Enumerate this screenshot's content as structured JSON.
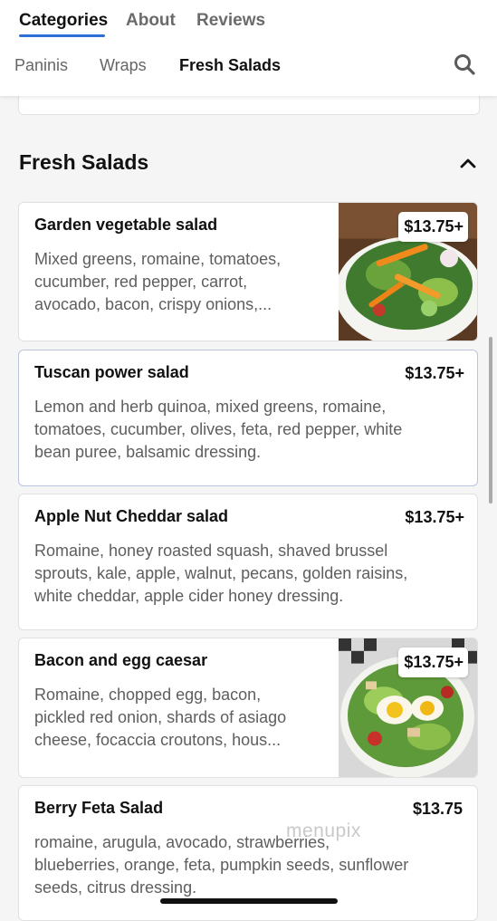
{
  "top_tabs": [
    {
      "label": "Categories",
      "active": true
    },
    {
      "label": "About",
      "active": false
    },
    {
      "label": "Reviews",
      "active": false
    }
  ],
  "sub_tabs": [
    {
      "label": "Paninis",
      "active": false
    },
    {
      "label": "Wraps",
      "active": false
    },
    {
      "label": "Fresh Salads",
      "active": true
    }
  ],
  "icons": {
    "search": "search-icon",
    "collapse": "chevron-up-icon"
  },
  "section": {
    "title": "Fresh Salads"
  },
  "items": [
    {
      "name": "Garden vegetable salad",
      "desc_lines": [
        "Mixed greens, romaine, tomatoes,",
        "cucumber, red pepper, carrot,",
        "avocado, bacon, crispy onions,..."
      ],
      "price": "$13.75+",
      "has_image": true
    },
    {
      "name": "Tuscan power salad",
      "desc_lines": [
        "Lemon and herb quinoa, mixed greens, romaine,",
        "tomatoes, cucumber, olives, feta, red pepper, white",
        "bean puree, balsamic dressing."
      ],
      "price": "$13.75+",
      "has_image": false
    },
    {
      "name": "Apple Nut Cheddar salad",
      "desc_lines": [
        "Romaine, honey roasted squash, shaved brussel",
        "sprouts, kale, apple, walnut, pecans, golden raisins,",
        "white cheddar, apple cider honey dressing."
      ],
      "price": "$13.75+",
      "has_image": false
    },
    {
      "name": "Bacon and egg caesar",
      "desc_lines": [
        "Romaine, chopped egg, bacon,",
        "pickled red onion, shards of asiago",
        "cheese, focaccia croutons, hous..."
      ],
      "price": "$13.75+",
      "has_image": true
    },
    {
      "name": "Berry Feta Salad",
      "desc_lines": [
        "romaine, arugula, avocado, strawberries,",
        "blueberries, orange, feta, pumpkin seeds, sunflower",
        "seeds, citrus dressing."
      ],
      "price": "$13.75",
      "has_image": false
    }
  ],
  "watermark": "menupix",
  "colors": {
    "accent": "#2c6fd6",
    "text": "#111111",
    "muted": "#5e5e5e"
  }
}
